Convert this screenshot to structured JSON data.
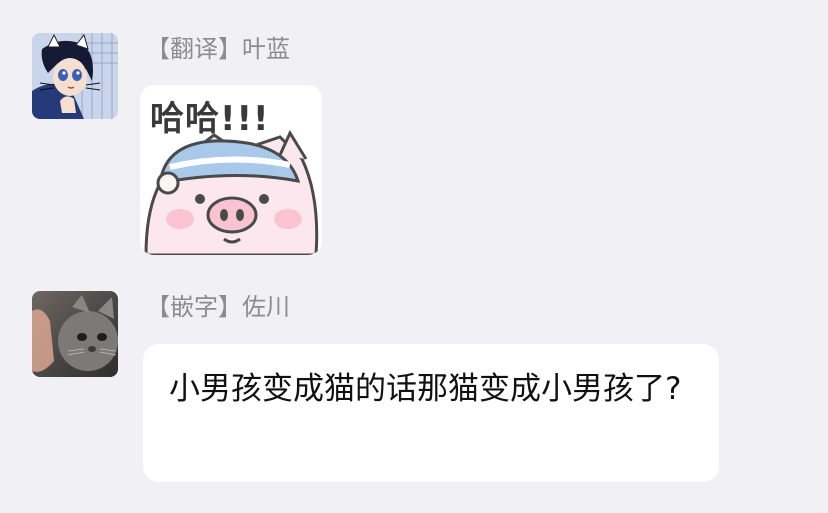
{
  "messages": [
    {
      "avatar_icon": "anime-boy-cat-ears-avatar",
      "sender": "【翻译】叶蓝",
      "sticker": {
        "icon": "pink-pig-sleeping-cap-sticker",
        "text": "哈哈!!!"
      }
    },
    {
      "avatar_icon": "grey-cat-photo-avatar",
      "sender": "【嵌字】佐川",
      "text": "小男孩变成猫的话那猫变成小男孩了?"
    }
  ],
  "colors": {
    "background": "#f1f1f5",
    "bubble": "#ffffff",
    "sender_text": "#8b8b91",
    "message_text": "#111111"
  }
}
